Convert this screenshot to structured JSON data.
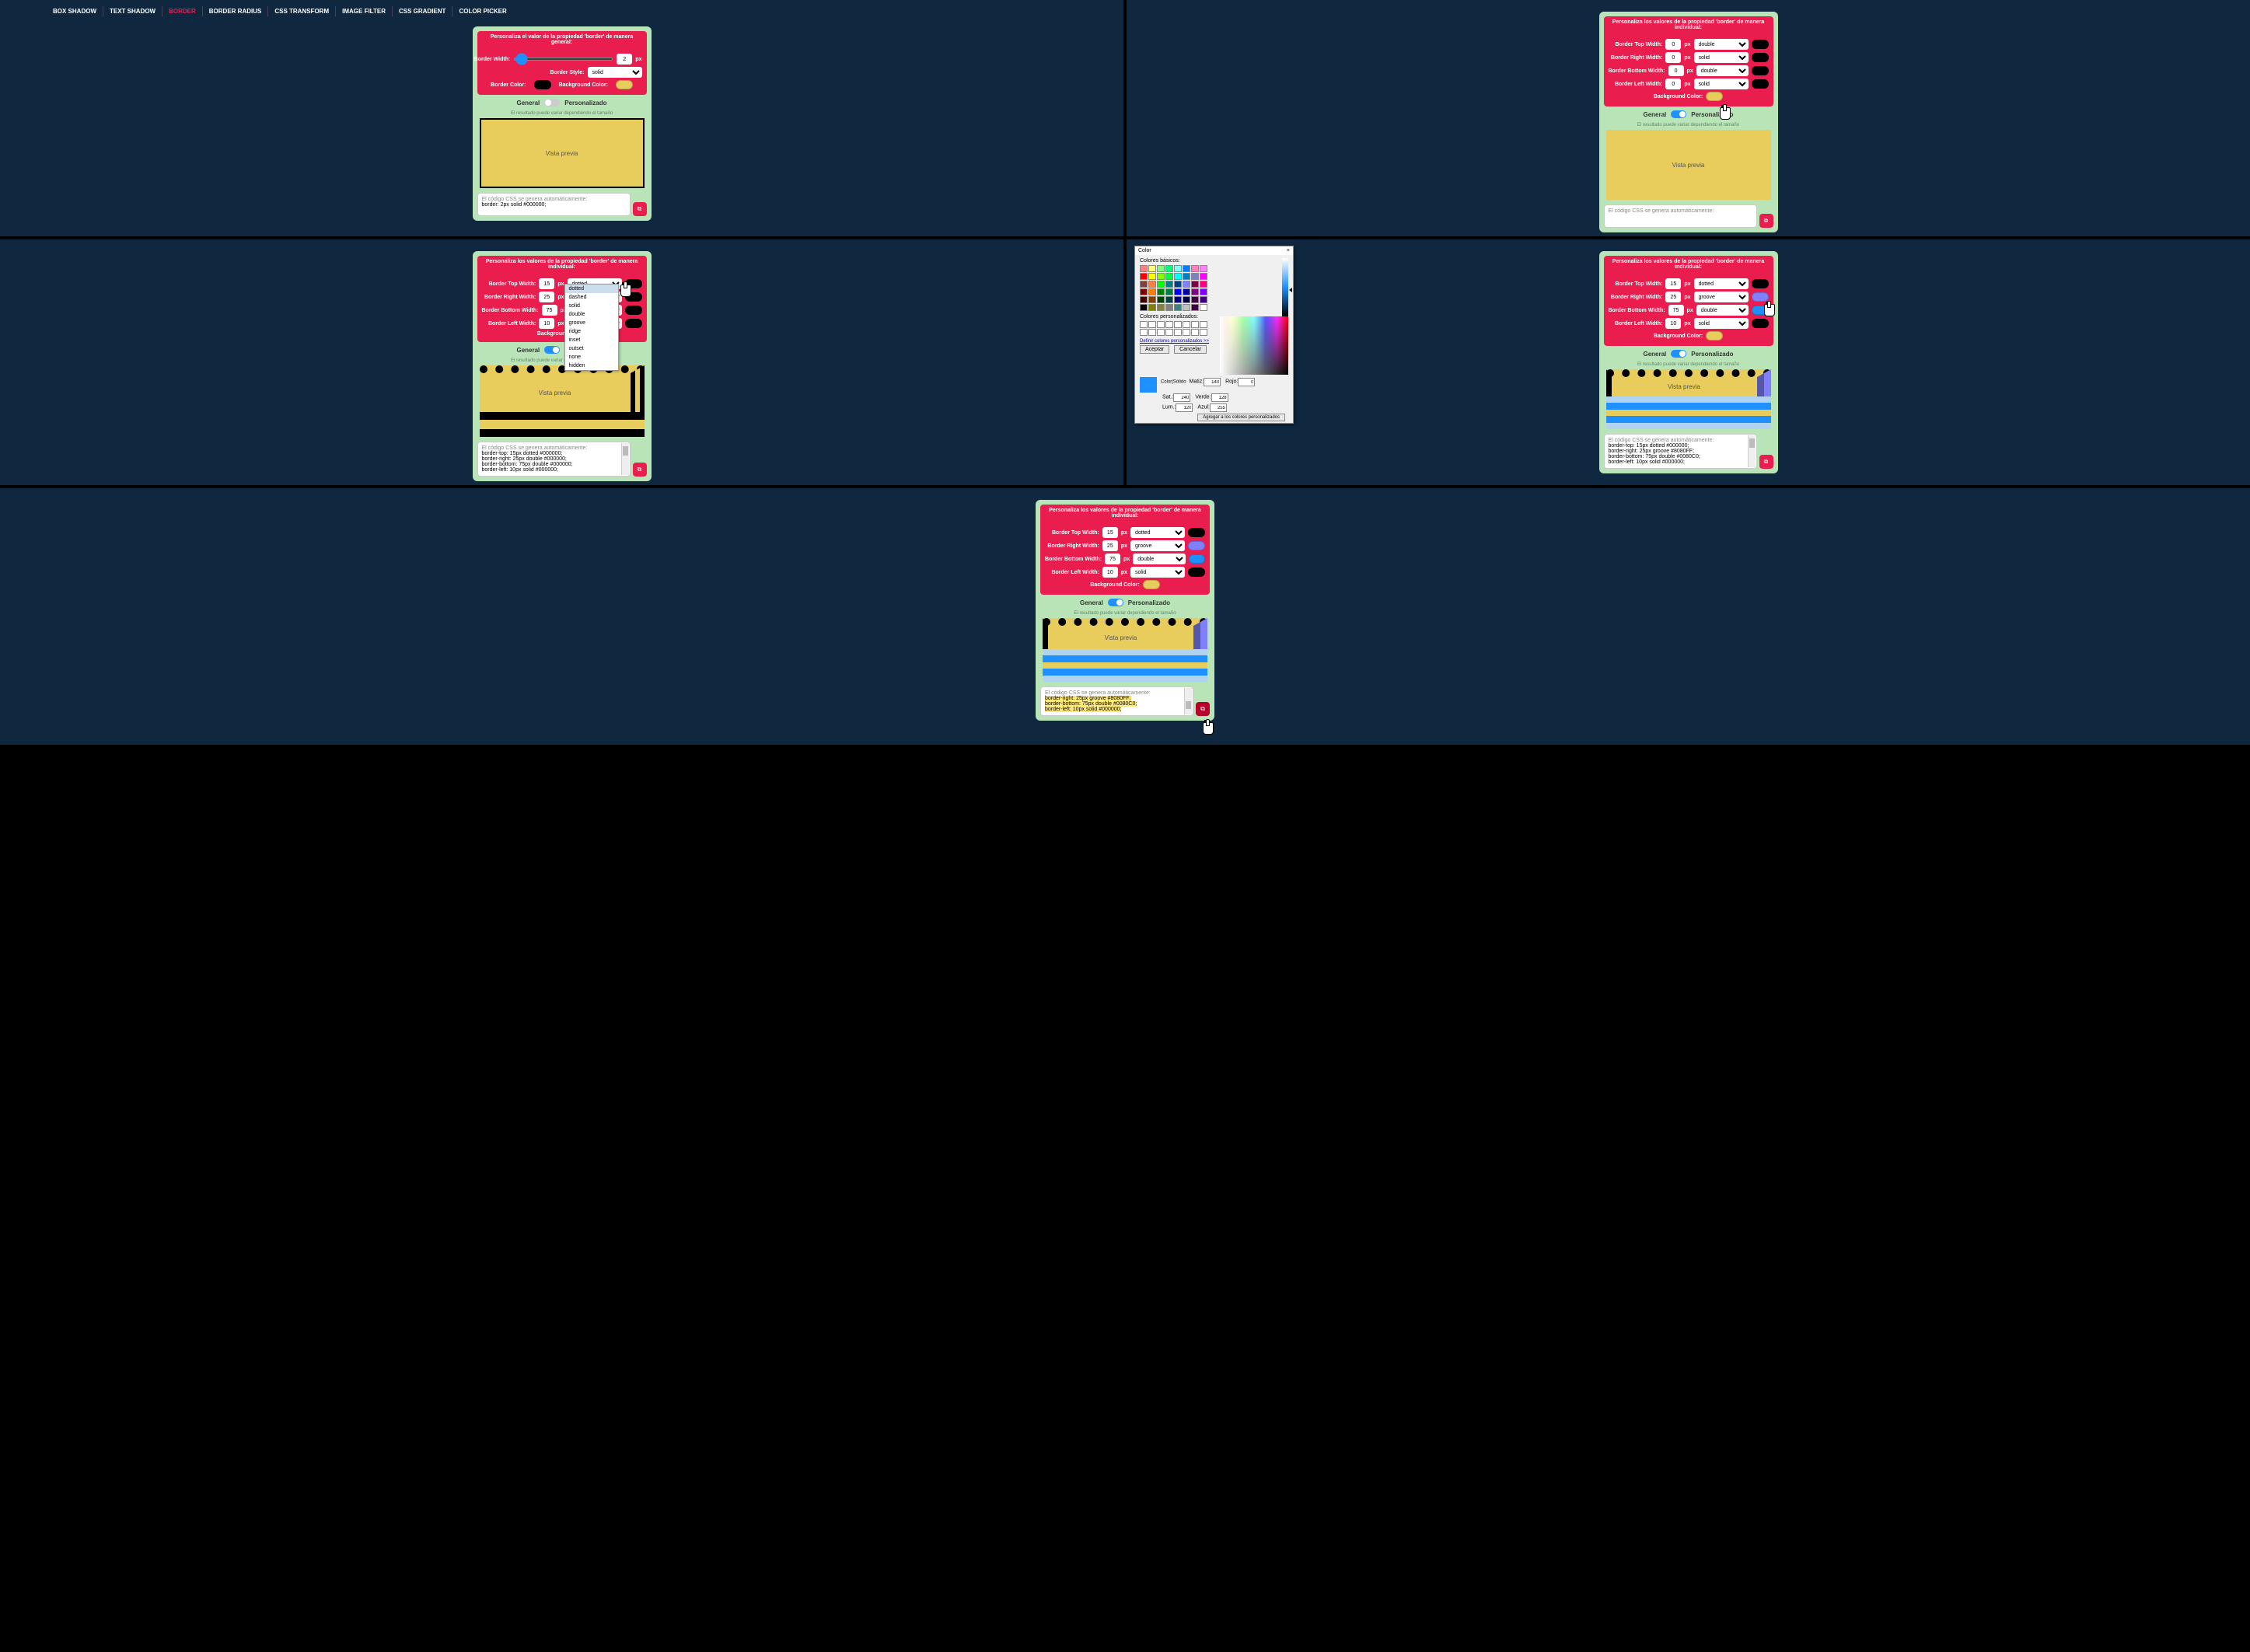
{
  "nav": [
    "BOX SHADOW",
    "TEXT SHADOW",
    "BORDER",
    "BORDER RADIUS",
    "CSS TRANSFORM",
    "IMAGE FILTER",
    "CSS GRADIENT",
    "COLOR PICKER"
  ],
  "nav_active": "BORDER",
  "labels": {
    "header_general": "Personaliza el valor de la propiedad 'border' de manera general:",
    "header_individual": "Personaliza los valores de la propiedad 'border' de manera individual:",
    "border_width": "Border Width:",
    "border_style": "Border Style:",
    "border_color": "Border Color:",
    "background_color": "Background Color:",
    "border_top": "Border Top Width:",
    "border_right": "Border Right Width:",
    "border_bottom": "Border Bottom Width:",
    "border_left": "Border Left Width:",
    "general": "General",
    "personalizado": "Personalizado",
    "hint": "El resultado puede variar dependiendo el tamaño",
    "preview": "Vista previa",
    "code_auto": "El código CSS se genera automáticamente:",
    "px": "px"
  },
  "dropdown_options": [
    "dotted",
    "dashed",
    "solid",
    "double",
    "groove",
    "ridge",
    "inset",
    "outset",
    "none",
    "hidden"
  ],
  "screen1": {
    "width": "2",
    "style": "solid",
    "border_color": "#000000",
    "bg_color": "#e8cc5c",
    "toggle_on": false,
    "code": "border: 2px solid #000000;"
  },
  "screen2": {
    "top": {
      "w": "0",
      "style": "double",
      "color": "#000000"
    },
    "right": {
      "w": "0",
      "style": "solid",
      "color": "#000000"
    },
    "bottom": {
      "w": "0",
      "style": "double",
      "color": "#000000"
    },
    "left": {
      "w": "0",
      "style": "solid",
      "color": "#000000"
    },
    "bg_color": "#e8cc5c",
    "toggle_on": true,
    "code": ""
  },
  "screen3": {
    "top": {
      "w": "15",
      "style": "dotted",
      "color": "#000000"
    },
    "right": {
      "w": "25",
      "style": "",
      "color": "#000000"
    },
    "bottom": {
      "w": "75",
      "style": "",
      "color": "#000000"
    },
    "left": {
      "w": "10",
      "style": "",
      "color": "#000000"
    },
    "toggle_on": true,
    "code": "border-top: 15px dotted #000000;\nborder-right: 25px double #000000;\nborder-bottom: 75px double #000000;\nborder-left: 10px solid #000000;"
  },
  "screen4": {
    "top": {
      "w": "15",
      "style": "dotted",
      "color": "#000000"
    },
    "right": {
      "w": "25",
      "style": "groove",
      "color": "#8080ff"
    },
    "bottom": {
      "w": "75",
      "style": "double",
      "color": "#1e90ff"
    },
    "left": {
      "w": "10",
      "style": "solid",
      "color": "#000000"
    },
    "bg_color": "#e8cc5c",
    "toggle_on": true,
    "code": "border-top: 15px dotted #000000;\nborder-right: 25px groove #8080FF;\nborder-bottom: 75px double #0080C0;\nborder-left: 10px solid #000000;"
  },
  "screen5": {
    "top": {
      "w": "15",
      "style": "dotted",
      "color": "#000000"
    },
    "right": {
      "w": "25",
      "style": "groove",
      "color": "#8080ff"
    },
    "bottom": {
      "w": "75",
      "style": "double",
      "color": "#1e90ff"
    },
    "left": {
      "w": "10",
      "style": "solid",
      "color": "#000000"
    },
    "bg_color": "#e8cc5c",
    "toggle_on": true,
    "code_lines": [
      "border-right: 25px groove #8080FF;",
      "border-bottom: 75px double #0080C0;",
      "border-left: 10px solid #000000;"
    ]
  },
  "color_dialog": {
    "title": "Color",
    "basic": "Colores básicos:",
    "custom": "Colores personalizados:",
    "define": "Definir colores personalizados >>",
    "accept": "Aceptar",
    "cancel": "Cancelar",
    "add": "Agregar a los colores personalizados",
    "solid": "Color|Sólido",
    "matiz": "Matiz:",
    "mval": "140",
    "sat": "Sat.:",
    "sval": "240",
    "lum": "Lum.:",
    "lval": "120",
    "rojo": "Rojo:",
    "rval": "0",
    "verde": "Verde:",
    "vval": "128",
    "azul": "Azul:",
    "aval": "255",
    "basic_colors": [
      "#ff8080",
      "#ffff80",
      "#80ff80",
      "#00ff80",
      "#80ffff",
      "#0080ff",
      "#ff80c0",
      "#ff80ff",
      "#ff0000",
      "#ffff00",
      "#80ff00",
      "#00ff40",
      "#00ffff",
      "#0080c0",
      "#8080c0",
      "#ff00ff",
      "#804040",
      "#ff8040",
      "#00ff00",
      "#008080",
      "#004080",
      "#8080ff",
      "#800040",
      "#ff0080",
      "#800000",
      "#ff8000",
      "#008000",
      "#008040",
      "#0000ff",
      "#0000a0",
      "#800080",
      "#8000ff",
      "#400000",
      "#804000",
      "#004000",
      "#004040",
      "#000080",
      "#000040",
      "#400040",
      "#400080",
      "#000000",
      "#808000",
      "#808040",
      "#808080",
      "#408080",
      "#c0c0c0",
      "#400040",
      "#ffffff"
    ]
  }
}
